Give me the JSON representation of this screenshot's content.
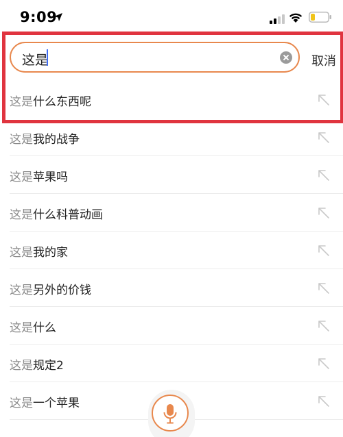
{
  "status_bar": {
    "time": "9:09",
    "location_icon": "location-arrow-icon",
    "signal_icon": "cellular-signal-icon",
    "wifi_icon": "wifi-icon",
    "battery_icon": "battery-low-icon",
    "battery_color": "#f0c419"
  },
  "search": {
    "query": "这是",
    "clear_icon": "clear-icon",
    "cancel_label": "取消",
    "accent_color": "#e8884d"
  },
  "highlight_color": "#e0343f",
  "suggestions": [
    {
      "match": "这是",
      "rest": "什么东西呢",
      "icon": "fill-arrow-icon"
    },
    {
      "match": "这是",
      "rest": "我的战争",
      "icon": "fill-arrow-icon"
    },
    {
      "match": "这是",
      "rest": "苹果吗",
      "icon": "fill-arrow-icon"
    },
    {
      "match": "这是",
      "rest": "什么科普动画",
      "icon": "fill-arrow-icon"
    },
    {
      "match": "这是",
      "rest": "我的家",
      "icon": "fill-arrow-icon"
    },
    {
      "match": "这是",
      "rest": "另外的价钱",
      "icon": "fill-arrow-icon"
    },
    {
      "match": "这是",
      "rest": "什么",
      "icon": "fill-arrow-icon"
    },
    {
      "match": "这是",
      "rest": "规定2",
      "icon": "fill-arrow-icon"
    },
    {
      "match": "这是",
      "rest": "一个苹果",
      "icon": "fill-arrow-icon"
    }
  ],
  "voice": {
    "icon": "microphone-icon"
  }
}
